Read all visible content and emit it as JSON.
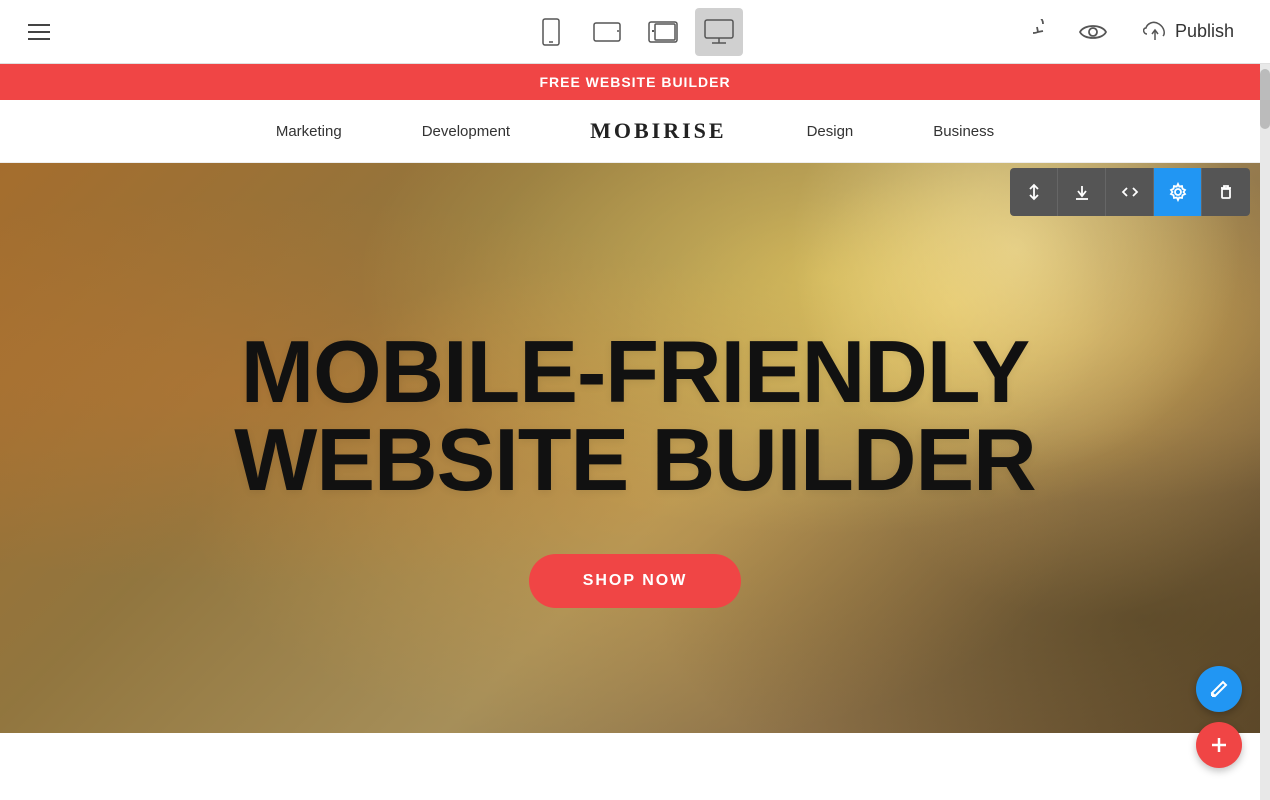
{
  "toolbar": {
    "hamburger_label": "Menu",
    "publish_label": "Publish",
    "devices": [
      {
        "id": "mobile",
        "label": "Mobile view"
      },
      {
        "id": "tablet",
        "label": "Tablet view"
      },
      {
        "id": "tablet-landscape",
        "label": "Tablet landscape view"
      },
      {
        "id": "desktop",
        "label": "Desktop view"
      }
    ]
  },
  "banner": {
    "text": "FREE WEBSITE BUILDER"
  },
  "nav": {
    "logo": "MOBIRISE",
    "items": [
      {
        "label": "Marketing"
      },
      {
        "label": "Development"
      },
      {
        "label": "Design"
      },
      {
        "label": "Business"
      }
    ]
  },
  "hero": {
    "title_line1": "MOBILE-FRIENDLY",
    "title_line2": "WEBSITE BUILDER",
    "cta_label": "SHOP NOW"
  },
  "block_tools": [
    {
      "id": "reorder",
      "label": "Reorder"
    },
    {
      "id": "download",
      "label": "Download"
    },
    {
      "id": "code",
      "label": "Code"
    },
    {
      "id": "settings",
      "label": "Settings"
    },
    {
      "id": "delete",
      "label": "Delete"
    }
  ],
  "colors": {
    "accent_red": "#f04545",
    "accent_blue": "#2196f3",
    "hero_bg": "#7a6040"
  }
}
